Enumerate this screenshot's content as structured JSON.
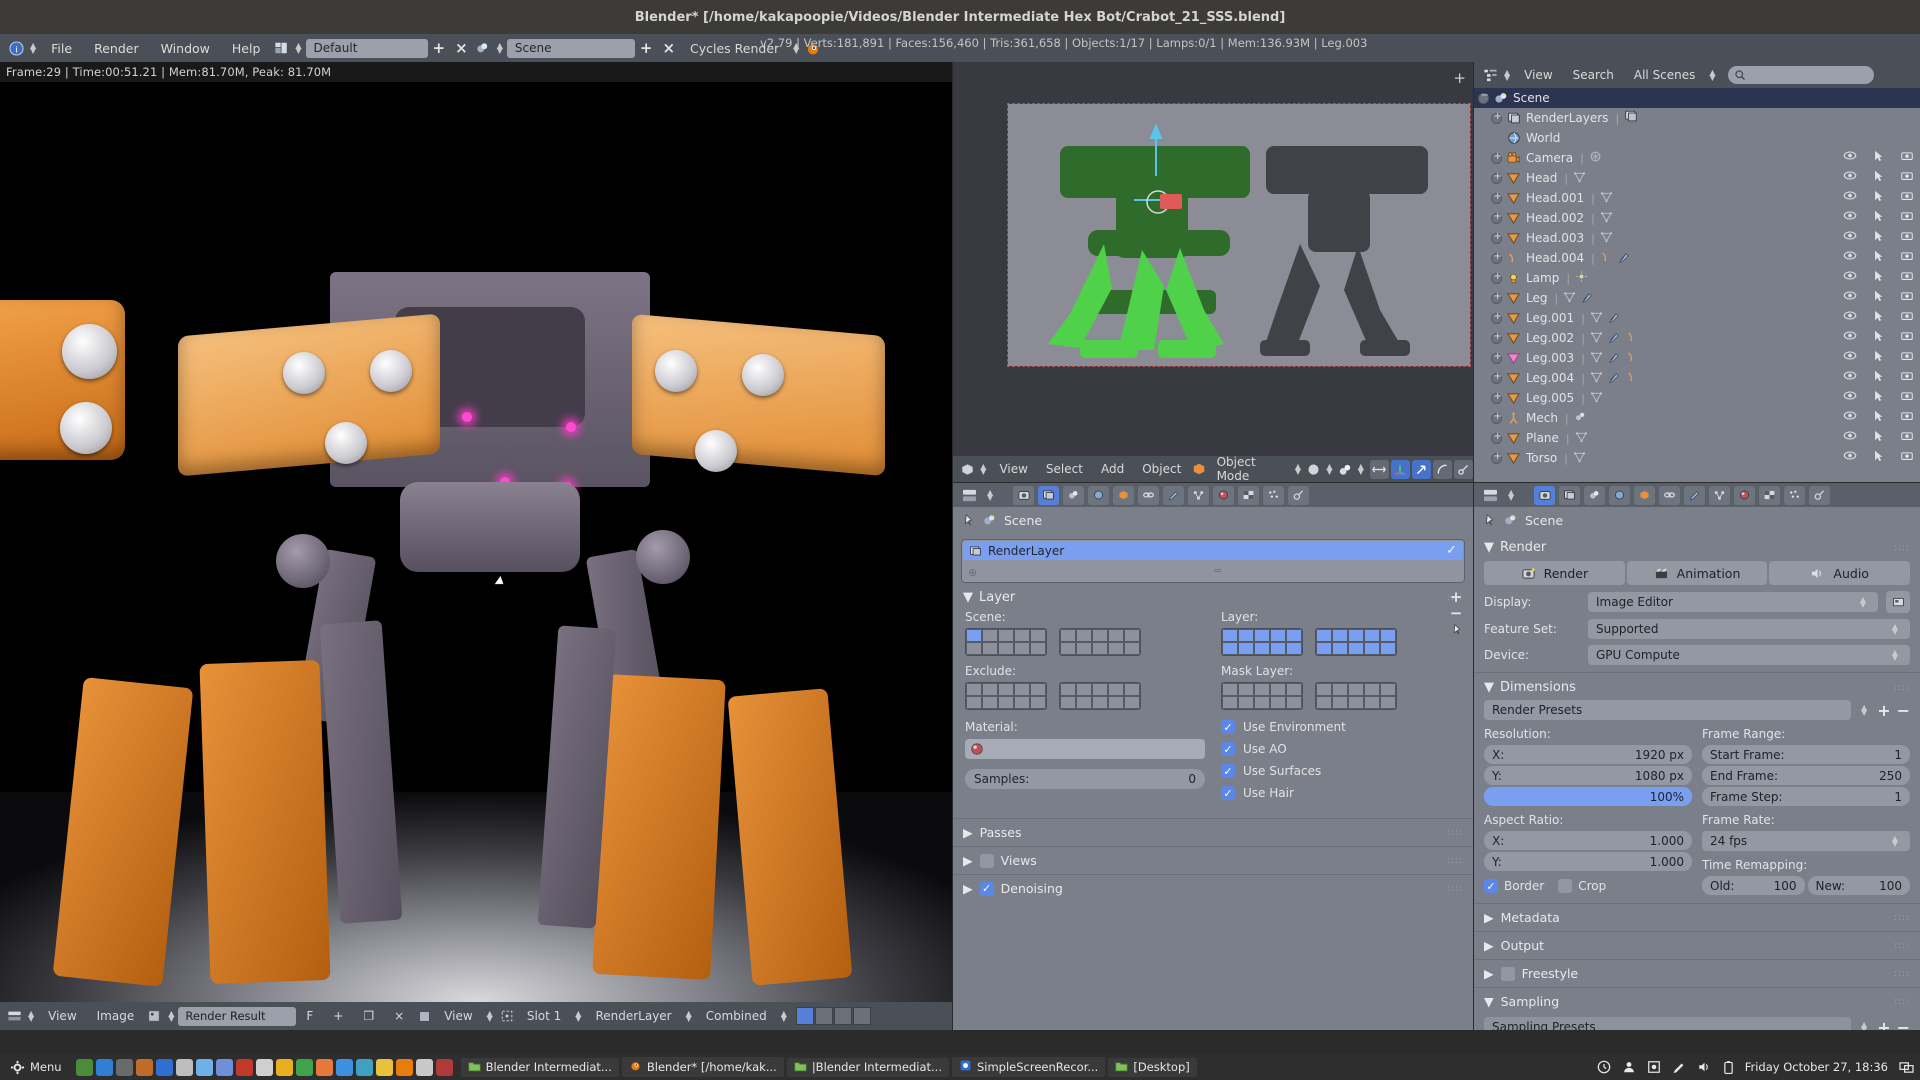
{
  "window": {
    "title": "Blender* [/home/kakapoopie/Videos/Blender Intermediate Hex Bot/Crabot_21_SSS.blend]"
  },
  "topbar": {
    "menus": [
      "File",
      "Render",
      "Window",
      "Help"
    ],
    "screen_layout": "Default",
    "scene_name": "Scene",
    "engine": "Cycles Render",
    "add_label": "+",
    "close_label": "×"
  },
  "stats": "v2.79 | Verts:181,891 | Faces:156,460 | Tris:361,658 | Objects:1/17 | Lamps:0/1 | Mem:136.93M | Leg.003",
  "render_hud": "Frame:29 | Time:00:51.21 | Mem:81.70M, Peak: 81.70M",
  "image_editor_footer": {
    "view_label": "View",
    "image_label": "Image",
    "datablock": "Render Result",
    "fake_user": "F",
    "plus": "+",
    "copy": "❐",
    "x": "×",
    "view2": "View",
    "slot": "Slot 1",
    "layer": "RenderLayer",
    "pass": "Combined"
  },
  "viewport": {
    "menus": [
      "View",
      "Select",
      "Add",
      "Object"
    ],
    "mode": "Object Mode",
    "shading": "solid",
    "pivot": "median"
  },
  "outliner": {
    "header": {
      "view": "View",
      "search": "Search",
      "display_mode": "All Scenes",
      "search_placeholder": ""
    },
    "rows": [
      {
        "label": "Scene",
        "icon": "scene-icon",
        "depth": 0,
        "selected": true,
        "expand": "minus",
        "subicons": [],
        "cols": false
      },
      {
        "label": "RenderLayers",
        "icon": "renderlayers-icon",
        "depth": 1,
        "selected": false,
        "expand": "plus",
        "subicons": [
          "renderlayer-icon"
        ],
        "cols": false
      },
      {
        "label": "World",
        "icon": "world-icon",
        "depth": 1,
        "selected": false,
        "expand": "none",
        "subicons": [],
        "cols": false
      },
      {
        "label": "Camera",
        "icon": "camera-icon",
        "depth": 1,
        "selected": false,
        "expand": "plus",
        "subicons": [
          "camera-data-icon"
        ],
        "cols": true
      },
      {
        "label": "Head",
        "icon": "mesh-icon",
        "depth": 1,
        "selected": false,
        "expand": "plus",
        "subicons": [
          "mesh-data-icon"
        ],
        "cols": true
      },
      {
        "label": "Head.001",
        "icon": "mesh-icon",
        "depth": 1,
        "selected": false,
        "expand": "plus",
        "subicons": [
          "mesh-data-icon"
        ],
        "cols": true
      },
      {
        "label": "Head.002",
        "icon": "mesh-icon",
        "depth": 1,
        "selected": false,
        "expand": "plus",
        "subicons": [
          "mesh-data-icon"
        ],
        "cols": true
      },
      {
        "label": "Head.003",
        "icon": "mesh-icon",
        "depth": 1,
        "selected": false,
        "expand": "plus",
        "subicons": [
          "mesh-data-icon"
        ],
        "cols": true
      },
      {
        "label": "Head.004",
        "icon": "curve-icon",
        "depth": 1,
        "selected": false,
        "expand": "plus",
        "subicons": [
          "curve-data-icon",
          "modifier-icon"
        ],
        "cols": true
      },
      {
        "label": "Lamp",
        "icon": "lamp-icon",
        "depth": 1,
        "selected": false,
        "expand": "plus",
        "subicons": [
          "lamp-data-icon"
        ],
        "cols": true
      },
      {
        "label": "Leg",
        "icon": "mesh-icon",
        "depth": 1,
        "selected": false,
        "expand": "plus",
        "subicons": [
          "mesh-data-icon",
          "modifier-icon"
        ],
        "cols": true
      },
      {
        "label": "Leg.001",
        "icon": "mesh-icon",
        "depth": 1,
        "selected": false,
        "expand": "plus",
        "subicons": [
          "mesh-data-icon",
          "modifier-icon"
        ],
        "cols": true
      },
      {
        "label": "Leg.002",
        "icon": "mesh-icon",
        "depth": 1,
        "selected": false,
        "expand": "plus",
        "subicons": [
          "mesh-data-icon",
          "modifier-icon",
          "curve-data-icon"
        ],
        "cols": true
      },
      {
        "label": "Leg.003",
        "icon": "mesh-icon-active",
        "depth": 1,
        "selected": false,
        "expand": "plus",
        "subicons": [
          "mesh-data-icon",
          "modifier-icon",
          "curve-data-icon"
        ],
        "cols": true
      },
      {
        "label": "Leg.004",
        "icon": "mesh-icon",
        "depth": 1,
        "selected": false,
        "expand": "plus",
        "subicons": [
          "mesh-data-icon",
          "modifier-icon",
          "curve-data-icon"
        ],
        "cols": true
      },
      {
        "label": "Leg.005",
        "icon": "mesh-icon",
        "depth": 1,
        "selected": false,
        "expand": "plus",
        "subicons": [
          "mesh-data-icon"
        ],
        "cols": true
      },
      {
        "label": "Mech",
        "icon": "armature-icon",
        "depth": 1,
        "selected": false,
        "expand": "plus",
        "subicons": [
          "armature-data-icon"
        ],
        "cols": true
      },
      {
        "label": "Plane",
        "icon": "mesh-icon",
        "depth": 1,
        "selected": false,
        "expand": "plus",
        "subicons": [
          "mesh-data-icon"
        ],
        "cols": true
      },
      {
        "label": "Torso",
        "icon": "mesh-icon",
        "depth": 1,
        "selected": false,
        "expand": "plus",
        "subicons": [
          "mesh-data-icon"
        ],
        "cols": true
      }
    ]
  },
  "renderlayer_props": {
    "breadcrumb": "Scene",
    "list_item": "RenderLayer",
    "section_layer": "Layer",
    "scene_label": "Scene:",
    "layer_label": "Layer:",
    "exclude_label": "Exclude:",
    "mask_layer_label": "Mask Layer:",
    "material_label": "Material:",
    "material_value": "",
    "samples_label": "Samples:",
    "samples_value": "0",
    "checkboxes": [
      {
        "label": "Use Environment",
        "checked": true
      },
      {
        "label": "Use AO",
        "checked": true
      },
      {
        "label": "Use Surfaces",
        "checked": true
      },
      {
        "label": "Use Hair",
        "checked": true
      }
    ],
    "scene_layers": [
      true,
      false,
      false,
      false,
      false,
      false,
      false,
      false,
      false,
      false,
      false,
      false,
      false,
      false,
      false,
      false,
      false,
      false,
      false,
      false
    ],
    "layer_layers": [
      true,
      true,
      true,
      true,
      true,
      true,
      true,
      true,
      true,
      true,
      true,
      true,
      true,
      true,
      true,
      true,
      true,
      true,
      true,
      true
    ],
    "exclude_layers": [
      false,
      false,
      false,
      false,
      false,
      false,
      false,
      false,
      false,
      false,
      false,
      false,
      false,
      false,
      false,
      false,
      false,
      false,
      false,
      false
    ],
    "mask_layers": [
      false,
      false,
      false,
      false,
      false,
      false,
      false,
      false,
      false,
      false,
      false,
      false,
      false,
      false,
      false,
      false,
      false,
      false,
      false,
      false
    ],
    "collapsed": [
      {
        "label": "Passes",
        "checkbox": null
      },
      {
        "label": "Views",
        "checkbox": false
      },
      {
        "label": "Denoising",
        "checkbox": true
      }
    ]
  },
  "render_props": {
    "breadcrumb": "Scene",
    "sections": {
      "render": "Render",
      "dimensions": "Dimensions",
      "metadata": "Metadata",
      "output": "Output",
      "freestyle": "Freestyle",
      "sampling": "Sampling"
    },
    "buttons": {
      "render": "Render",
      "animation": "Animation",
      "audio": "Audio"
    },
    "display_label": "Display:",
    "display_value": "Image Editor",
    "feature_set_label": "Feature Set:",
    "feature_set_value": "Supported",
    "device_label": "Device:",
    "device_value": "GPU Compute",
    "render_presets": "Render Presets",
    "resolution_label": "Resolution:",
    "res_x_label": "X:",
    "res_x_value": "1920 px",
    "res_y_label": "Y:",
    "res_y_value": "1080 px",
    "res_percent": "100%",
    "aspect_label": "Aspect Ratio:",
    "aspect_x_label": "X:",
    "aspect_x_value": "1.000",
    "aspect_y_label": "Y:",
    "aspect_y_value": "1.000",
    "border_label": "Border",
    "border_checked": true,
    "crop_label": "Crop",
    "crop_checked": false,
    "frame_range_label": "Frame Range:",
    "start_frame_label": "Start Frame:",
    "start_frame_value": "1",
    "end_frame_label": "End Frame:",
    "end_frame_value": "250",
    "frame_step_label": "Frame Step:",
    "frame_step_value": "1",
    "frame_rate_label": "Frame Rate:",
    "frame_rate_value": "24 fps",
    "time_remapping_label": "Time Remapping:",
    "old_label": "Old:",
    "old_value": "100",
    "new_label": "New:",
    "new_value": "100",
    "sampling_presets": "Sampling Presets"
  },
  "taskbar": {
    "menu_label": "Menu",
    "windows": [
      {
        "label": "Blender Intermediat...",
        "icon": "folder-icon"
      },
      {
        "label": "Blender* [/home/kak...",
        "icon": "blender-icon"
      },
      {
        "label": "|Blender Intermediat...",
        "icon": "folder-icon"
      },
      {
        "label": "SimpleScreenRecor...",
        "icon": "recorder-icon"
      },
      {
        "label": "[Desktop]",
        "icon": "folder-icon"
      }
    ],
    "clock": "Friday October 27, 18:36"
  },
  "colors": {
    "accent_blue": "#5680d8",
    "selection_blue": "#7a9ef0",
    "panel_bg": "#7b7f89",
    "header_bg": "#4b5058",
    "orange": "#d9953f",
    "active_pink": "#e86fc2"
  }
}
